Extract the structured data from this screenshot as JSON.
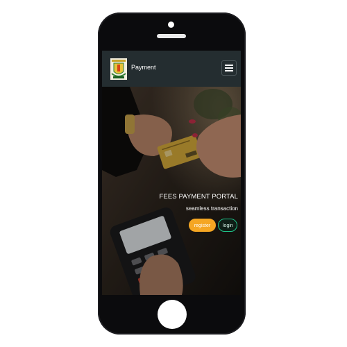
{
  "navbar": {
    "brand": "Payment",
    "logo_icon": "school-crest-icon",
    "menu_icon": "hamburger-menu-icon"
  },
  "hero": {
    "title": "FEES PAYMENT PORTAL",
    "subtitle": "seamless transaction",
    "register_label": "register",
    "login_label": "login",
    "register_color": "#f5a623",
    "login_border_color": "#1fc48a",
    "background_image": "hand-passing-card-to-pos-terminal"
  },
  "colors": {
    "navbar_bg": "#242d30",
    "device_body": "#0b0b0d"
  }
}
